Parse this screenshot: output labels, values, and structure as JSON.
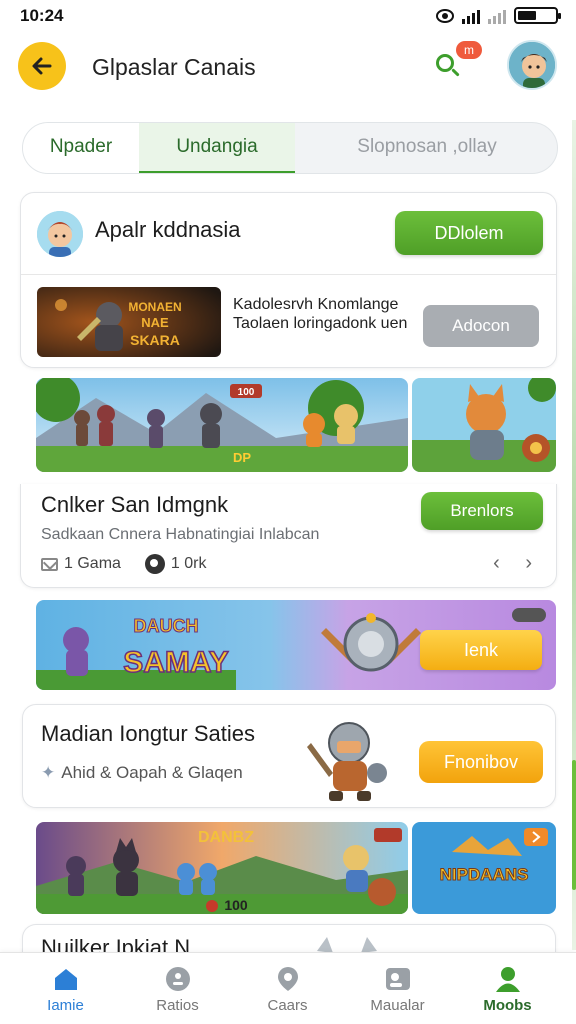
{
  "status": {
    "time": "10:24"
  },
  "header": {
    "title": "Glpaslar Canais",
    "badge": "m"
  },
  "tabs": [
    {
      "label": "Npader"
    },
    {
      "label": "Undangia"
    },
    {
      "label": "Slopnosan ,ollay"
    }
  ],
  "card1": {
    "name": "Apalr kddnasia",
    "download_button": "DDlolem",
    "thumb_title": "MONAEN\nNAE\nSKARA",
    "description": "Kadolesrvh Knomlange Taolaen loringadonk uen",
    "add_button": "Adocon"
  },
  "banner1": {
    "badge_a": "100",
    "badge_b": "DP"
  },
  "card2": {
    "title": "Cnlker San Idmgnk",
    "subtitle": "Sadkaan Cnnera Habnatingiai Inlabcan",
    "games": "1 Gama",
    "count": "1 0rk",
    "button": "Brenlors",
    "nav_glyphs": "‹ ›"
  },
  "banner2": {
    "logo": "SAMAY",
    "logo_top": "DAUCH",
    "button": "Ienk"
  },
  "card3": {
    "title": "Madian Iongtur Saties",
    "subtitle": "Ahid & Oapah & Glaqen",
    "button": "Fnonibov"
  },
  "banner3": {
    "logo_top": "DANBZ",
    "coins": "100",
    "right_logo": "NIPDAANS"
  },
  "card4": {
    "title": "Nuilker Ipkiat N"
  },
  "bottom_nav": [
    {
      "label": "Iamie"
    },
    {
      "label": "Ratios"
    },
    {
      "label": "Caars"
    },
    {
      "label": "Maualar"
    },
    {
      "label": "Moobs"
    }
  ],
  "colors": {
    "accent_green": "#4f9f27",
    "accent_yellow": "#f7c21a",
    "active_blue": "#2c7fd6"
  }
}
